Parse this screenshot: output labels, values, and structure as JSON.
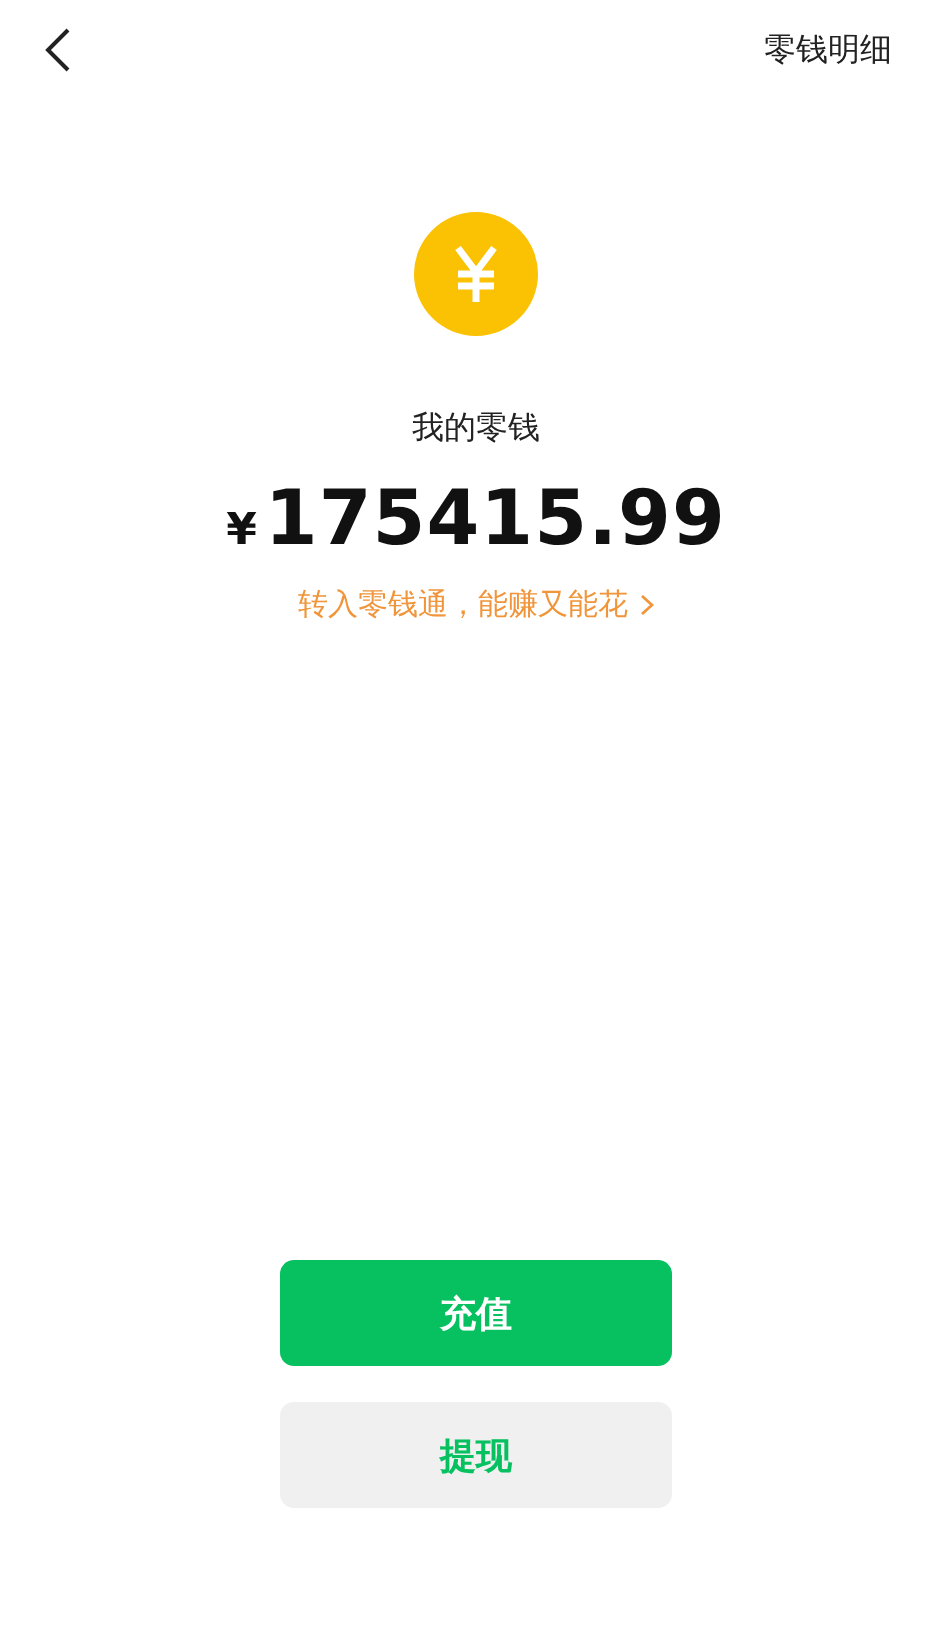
{
  "header": {
    "action": "零钱明细"
  },
  "balance": {
    "title": "我的零钱",
    "currency": "¥",
    "amount": "175415.99",
    "promo": "转入零钱通，能赚又能花"
  },
  "buttons": [
    {
      "label": "充值",
      "kind": "primary"
    },
    {
      "label": "提现",
      "kind": "secondary"
    }
  ]
}
